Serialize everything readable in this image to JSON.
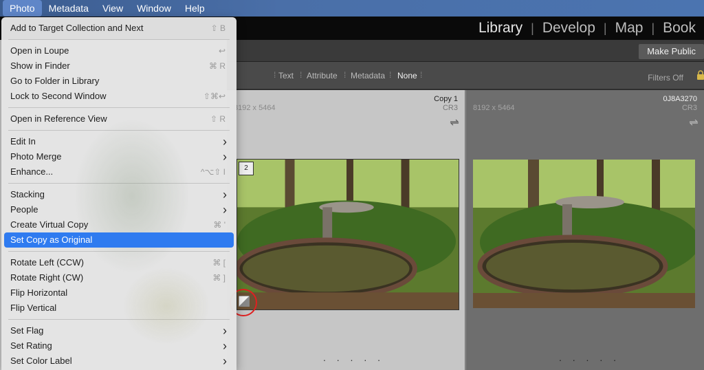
{
  "menubar": {
    "items": [
      "Photo",
      "Metadata",
      "View",
      "Window",
      "Help"
    ]
  },
  "modules": [
    "Library",
    "Develop",
    "Map",
    "Book"
  ],
  "make_public": "Make Public",
  "filterbar": {
    "items": [
      "Text",
      "Attribute",
      "Metadata",
      "None"
    ],
    "filters_off": "Filters Off"
  },
  "cells": [
    {
      "name": "Copy 1",
      "dims": "8192 x 5464",
      "ext": "CR3",
      "badge": "2",
      "dots": ". . . . ."
    },
    {
      "name": "0J8A3270",
      "dims": "8192 x 5464",
      "ext": "CR3",
      "dots": ". . . . ."
    }
  ],
  "menu": {
    "groups": [
      [
        {
          "label": "Add to Target Collection and Next",
          "shortcut": "⇧ B"
        }
      ],
      [
        {
          "label": "Open in Loupe",
          "shortcut": "↩"
        },
        {
          "label": "Show in Finder",
          "shortcut": "⌘ R"
        },
        {
          "label": "Go to Folder in Library",
          "shortcut": ""
        },
        {
          "label": "Lock to Second Window",
          "shortcut": "⇧⌘↩"
        }
      ],
      [
        {
          "label": "Open in Reference View",
          "shortcut": "⇧ R"
        }
      ],
      [
        {
          "label": "Edit In",
          "submenu": true
        },
        {
          "label": "Photo Merge",
          "submenu": true
        },
        {
          "label": "Enhance...",
          "shortcut": "^⌥⇧ I"
        }
      ],
      [
        {
          "label": "Stacking",
          "submenu": true
        },
        {
          "label": "People",
          "submenu": true
        },
        {
          "label": "Create Virtual Copy",
          "shortcut": "⌘ '"
        },
        {
          "label": "Set Copy as Original",
          "highlighted": true
        }
      ],
      [
        {
          "label": "Rotate Left (CCW)",
          "shortcut": "⌘ ["
        },
        {
          "label": "Rotate Right (CW)",
          "shortcut": "⌘ ]"
        },
        {
          "label": "Flip Horizontal",
          "shortcut": ""
        },
        {
          "label": "Flip Vertical",
          "shortcut": ""
        }
      ],
      [
        {
          "label": "Set Flag",
          "submenu": true
        },
        {
          "label": "Set Rating",
          "submenu": true
        },
        {
          "label": "Set Color Label",
          "submenu": true
        }
      ]
    ]
  },
  "colors": {
    "highlight": "#2f7bf0",
    "annotation_circle": "#e02020"
  }
}
